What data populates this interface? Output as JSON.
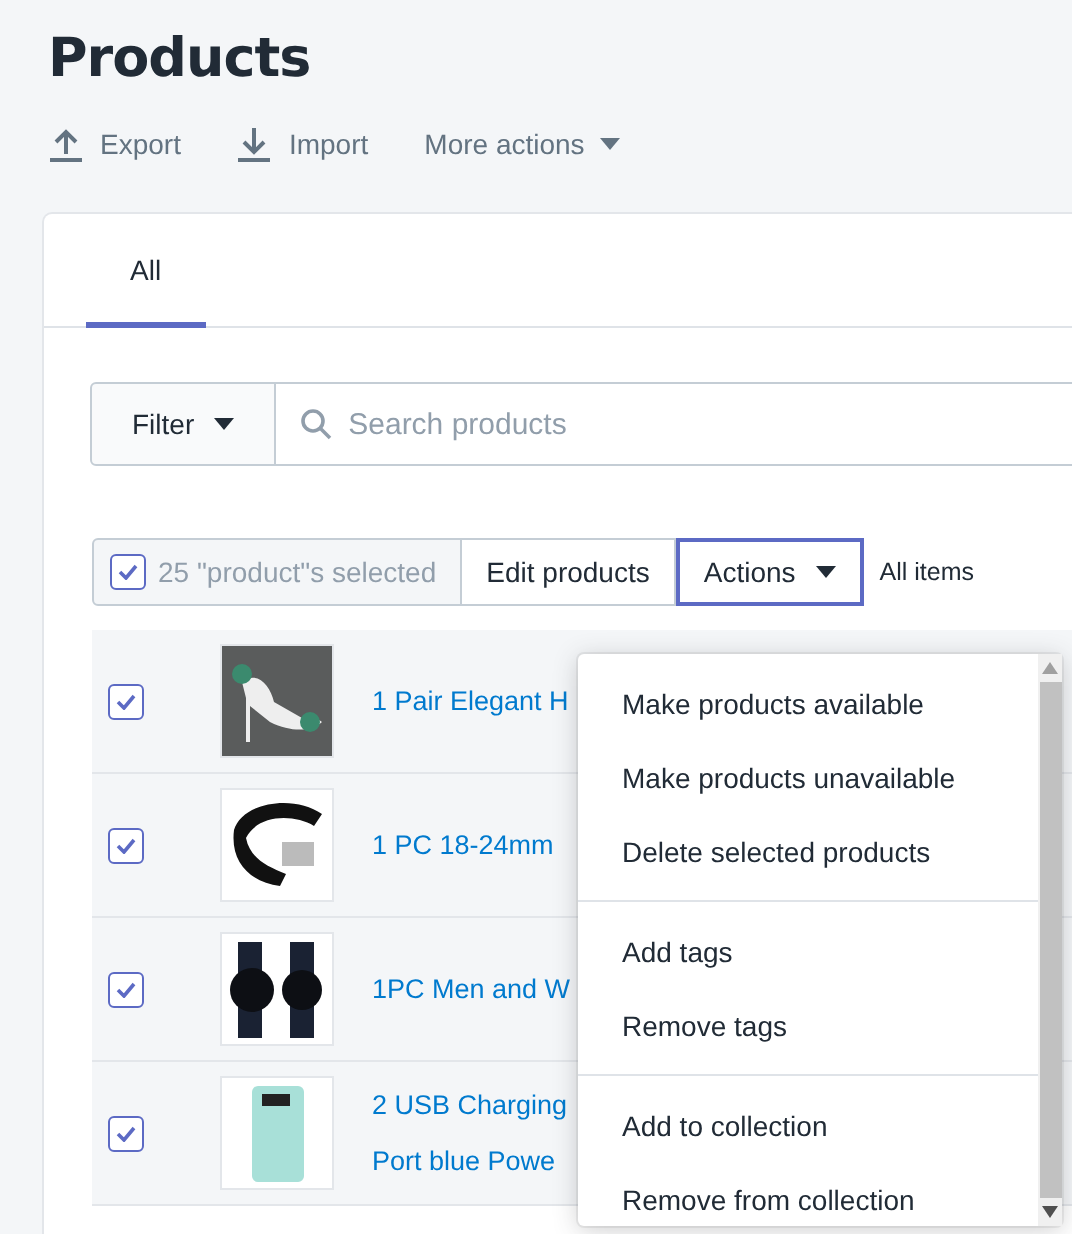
{
  "page": {
    "title": "Products"
  },
  "page_actions": [
    {
      "kind": "export",
      "label": "Export"
    },
    {
      "kind": "import",
      "label": "Import"
    },
    {
      "kind": "more",
      "label": "More actions"
    }
  ],
  "tabs": [
    {
      "label": "All",
      "selected": true
    }
  ],
  "filter": {
    "label": "Filter"
  },
  "search": {
    "placeholder": "Search products"
  },
  "bulk_bar": {
    "checked": true,
    "count_label": "25 \"product\"s selected",
    "edit_label": "Edit products",
    "actions_label": "Actions",
    "actions_expanded": true,
    "all_items_label": "All items"
  },
  "products": [
    {
      "checked": true,
      "title_lines": [
        "1 Pair Elegant H"
      ]
    },
    {
      "checked": true,
      "title_lines": [
        "1 PC 18-24mm"
      ]
    },
    {
      "checked": true,
      "title_lines": [
        "1PC Men and W"
      ]
    },
    {
      "checked": true,
      "title_lines": [
        "2 USB Charging",
        "Port blue Powe"
      ]
    }
  ],
  "actions_menu": {
    "groups": [
      [
        "Make products available",
        "Make products unavailable",
        "Delete selected products"
      ],
      [
        "Add tags",
        "Remove tags"
      ],
      [
        "Add to collection",
        "Remove from collection"
      ]
    ]
  }
}
